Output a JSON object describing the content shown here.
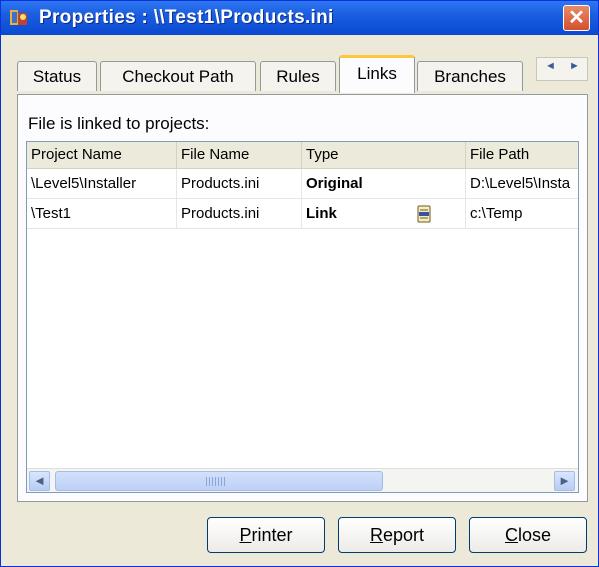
{
  "window": {
    "title": "Properties : \\\\Test1\\Products.ini",
    "close_label": "✕"
  },
  "tabs": [
    {
      "label": "Status",
      "active": false
    },
    {
      "label": "Checkout Path",
      "active": false
    },
    {
      "label": "Rules",
      "active": false
    },
    {
      "label": "Links",
      "active": true
    },
    {
      "label": "Branches",
      "active": false
    }
  ],
  "tab_scroll": {
    "left": "◄",
    "right": "►"
  },
  "panel": {
    "label": "File is linked to projects:"
  },
  "list": {
    "columns": [
      "Project Name",
      "File Name",
      "Type",
      "File Path"
    ],
    "rows": [
      {
        "project": "\\Level5\\Installer",
        "file": "Products.ini",
        "type": "Original",
        "path": "D:\\Level5\\Insta"
      },
      {
        "project": "\\Test1",
        "file": "Products.ini",
        "type": "Link",
        "path": "c:\\Temp",
        "icon": "linked-file-icon"
      }
    ]
  },
  "scrollbar": {
    "left": "◄",
    "right": "►",
    "grip": "|||"
  },
  "buttons": {
    "printer": {
      "first": "P",
      "rest": "rinter"
    },
    "report": {
      "first": "R",
      "rest": "eport"
    },
    "close": {
      "first": "C",
      "rest": "lose"
    }
  },
  "colors": {
    "titlebar": "#0a49d1",
    "active_tab_accent": "#ffc83c",
    "dialog_bg": "#ece9d8"
  }
}
